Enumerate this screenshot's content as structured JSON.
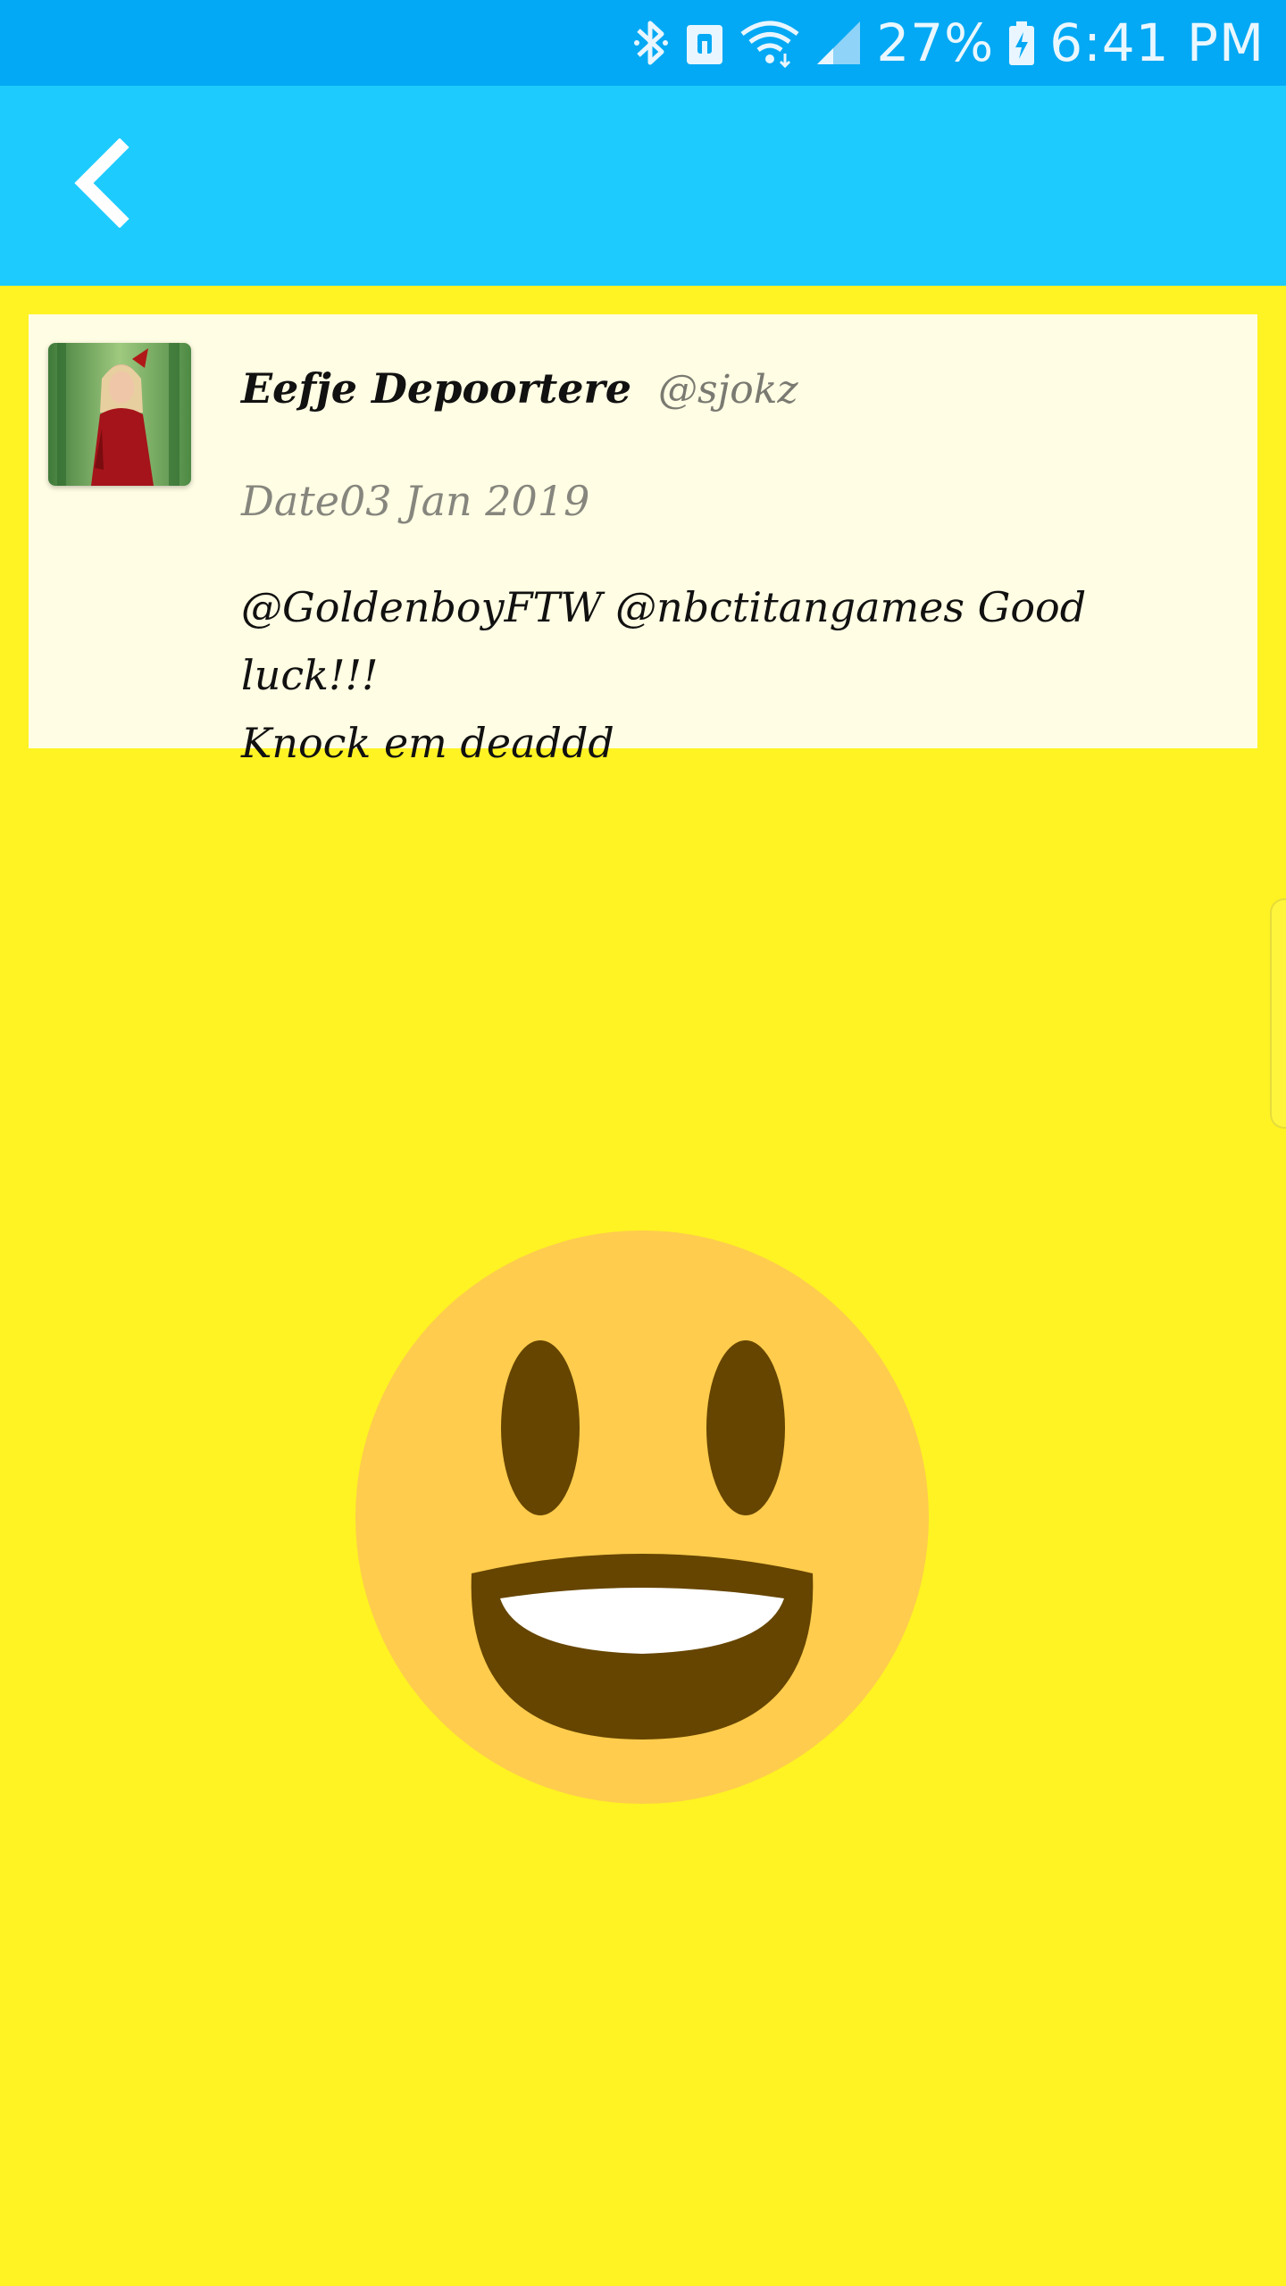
{
  "status_bar": {
    "battery": "27%",
    "time": "6:41 PM",
    "icons": [
      "bluetooth-icon",
      "nfc-icon",
      "wifi-icon",
      "signal-icon",
      "battery-charging-icon"
    ]
  },
  "app_bar": {
    "back_icon": "chevron-left-icon"
  },
  "tweet": {
    "name": "Eefje Depoortere",
    "handle": "@sjokz",
    "date": "Date03 Jan 2019",
    "text_line1": "@GoldenboyFTW @nbctitangames Good luck!!!",
    "text_line2": "Knock em deaddd"
  },
  "emoji": {
    "name": "grinning-face"
  },
  "colors": {
    "status_bar": "#03a9f4",
    "app_bar": "#1ecbff",
    "background": "#fff323",
    "card": "#fffde3",
    "emoji_face": "#ffcc4d",
    "emoji_features": "#664500"
  }
}
